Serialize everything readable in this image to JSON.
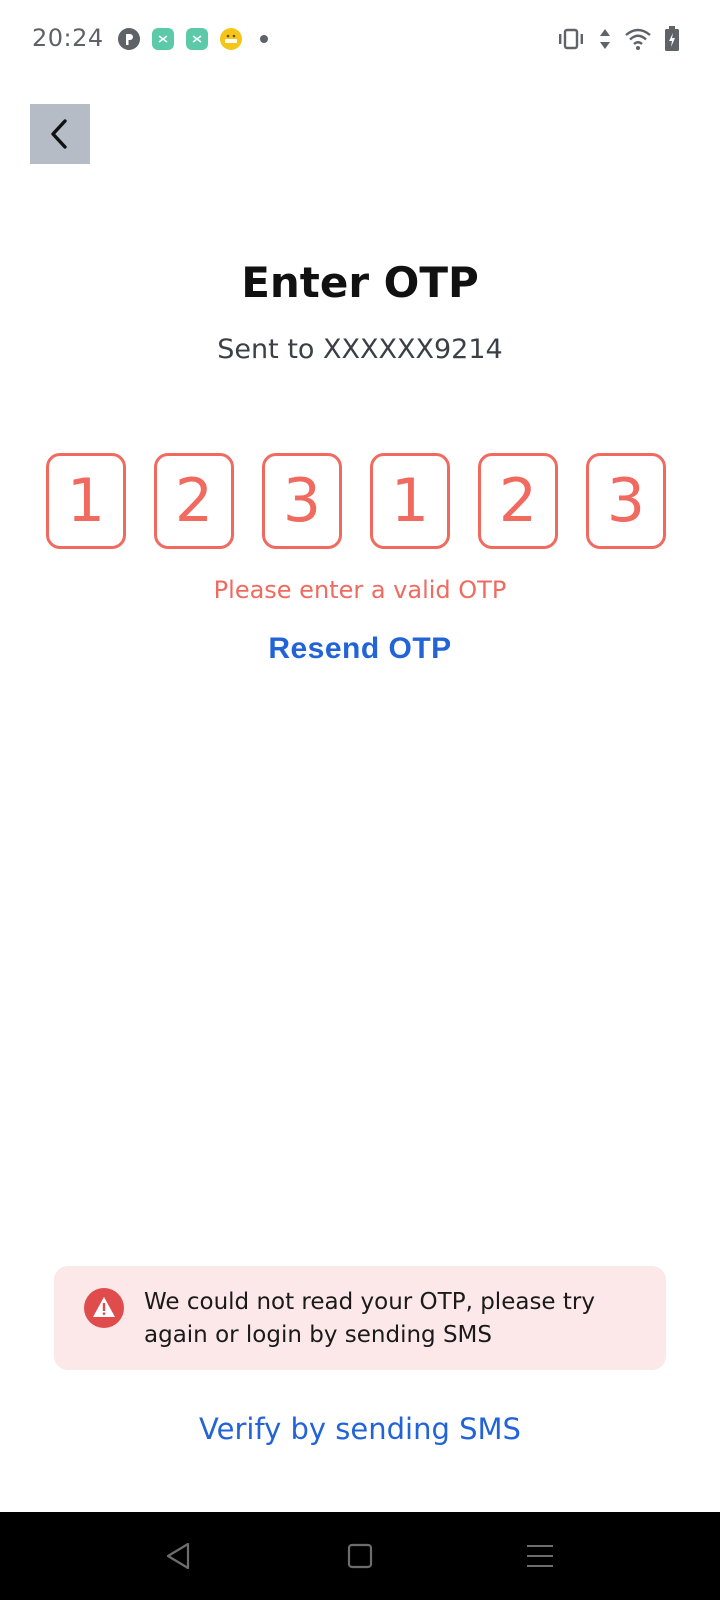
{
  "status_bar": {
    "time": "20:24",
    "notification_icons": [
      "p-circle-icon",
      "app-green-icon",
      "app-green-icon",
      "emoji-icon",
      "dot-icon"
    ],
    "system_icons": [
      "vibrate-icon",
      "data-arrows-icon",
      "wifi-icon",
      "battery-charging-icon"
    ]
  },
  "header": {
    "back_icon": "chevron-left-icon"
  },
  "main": {
    "title": "Enter OTP",
    "subtitle": "Sent to XXXXXX9214",
    "otp_digits": [
      "1",
      "2",
      "3",
      "1",
      "2",
      "3"
    ],
    "error_message": "Please enter a valid OTP",
    "resend_label": "Resend OTP"
  },
  "alert": {
    "icon": "warning-icon",
    "message": "We could not read your OTP, please try again or login by sending SMS"
  },
  "footer": {
    "verify_sms_label": "Verify by sending SMS"
  },
  "nav_bar": {
    "buttons": [
      "back-triangle-icon",
      "home-square-icon",
      "menu-lines-icon"
    ]
  },
  "colors": {
    "error": "#f06a60",
    "link": "#2264d8",
    "alert_bg": "#fce8e8",
    "back_button_bg": "#b6bcc6"
  }
}
